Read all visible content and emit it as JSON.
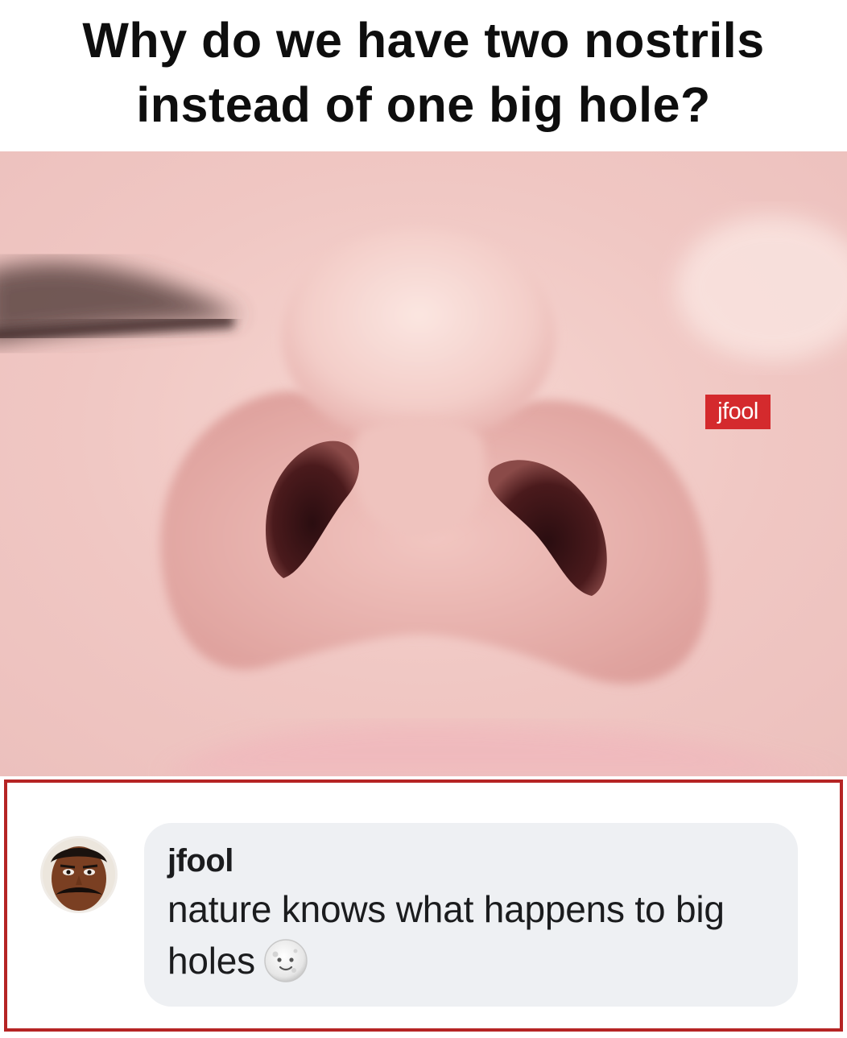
{
  "header": {
    "title": "Why do we have two nostrils instead of one big hole?"
  },
  "image": {
    "watermark": "jfool"
  },
  "comment": {
    "author": "jfool",
    "text": "nature knows what happens to big holes",
    "emoji": "new-moon-face-emoji"
  },
  "colors": {
    "frame_border": "#b52424",
    "watermark_bg": "#d42a2d",
    "bubble_bg": "#eef0f3"
  }
}
